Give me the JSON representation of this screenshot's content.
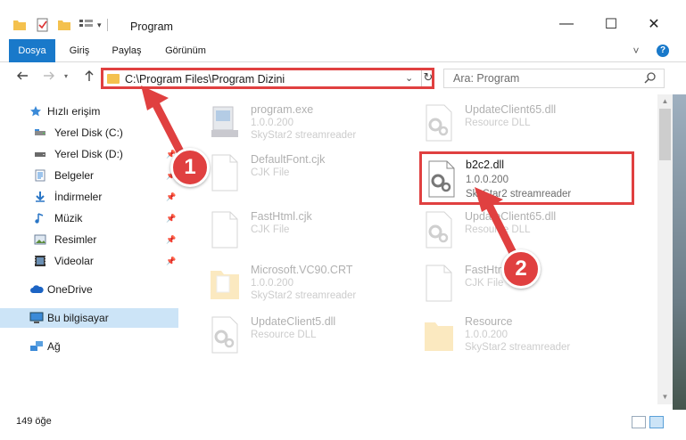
{
  "window": {
    "title": "Program",
    "minimize_glyph": "—",
    "maximize_glyph": "☐",
    "close_glyph": "✕"
  },
  "ribbon": {
    "tabs": [
      "Dosya",
      "Giriş",
      "Paylaş",
      "Görünüm"
    ],
    "help_glyph": "?",
    "expand_glyph": "˅"
  },
  "address": {
    "path": "C:\\Program Files\\Program Dizini",
    "search_placeholder": "Ara: Program"
  },
  "sidebar": {
    "quick_access": "Hızlı erişim",
    "items": [
      {
        "label": "Yerel Disk (C:)",
        "icon": "drive-icon"
      },
      {
        "label": "Yerel Disk (D:)",
        "icon": "drive-icon"
      },
      {
        "label": "Belgeler",
        "icon": "documents-icon"
      },
      {
        "label": "İndirmeler",
        "icon": "download-icon"
      },
      {
        "label": "Müzik",
        "icon": "music-icon"
      },
      {
        "label": "Resimler",
        "icon": "pictures-icon"
      },
      {
        "label": "Videolar",
        "icon": "videos-icon"
      }
    ],
    "onedrive": "OneDrive",
    "this_pc": "Bu bilgisayar",
    "network": "Ağ"
  },
  "files": [
    {
      "name": "program.exe",
      "line2": "1.0.0.200",
      "line3": "SkyStar2 streamreader",
      "icon": "exe-icon"
    },
    {
      "name": "UpdateClient65.dll",
      "line2": "Resource DLL",
      "line3": "",
      "icon": "dll-icon"
    },
    {
      "name": "DefaultFont.cjk",
      "line2": "CJK File",
      "line3": "",
      "icon": "blank-file-icon"
    },
    {
      "name": "b2c2.dll",
      "line2": "1.0.0.200",
      "line3": "SkyStar2 streamreader",
      "icon": "dll-icon"
    },
    {
      "name": "FastHtml.cjk",
      "line2": "CJK File",
      "line3": "",
      "icon": "blank-file-icon"
    },
    {
      "name": "UpdateClient65.dll",
      "line2": "Resource DLL",
      "line3": "",
      "icon": "dll-icon"
    },
    {
      "name": "Microsoft.VC90.CRT",
      "line2": "1.0.0.200",
      "line3": "SkyStar2 streamreader",
      "icon": "folder-icon"
    },
    {
      "name": "FastHtml.cjk",
      "line2": "CJK File",
      "line3": "",
      "icon": "blank-file-icon"
    },
    {
      "name": "UpdateClient5.dll",
      "line2": "Resource DLL",
      "line3": "",
      "icon": "dll-icon"
    },
    {
      "name": "Resource",
      "line2": "1.0.0.200",
      "line3": "SkyStar2 streamreader",
      "icon": "folder-icon"
    }
  ],
  "status": {
    "item_count": "149 öğe"
  },
  "callouts": [
    "1",
    "2"
  ],
  "colors": {
    "accent": "#1979ca",
    "highlight": "#e04040",
    "selection": "#cce4f7"
  }
}
